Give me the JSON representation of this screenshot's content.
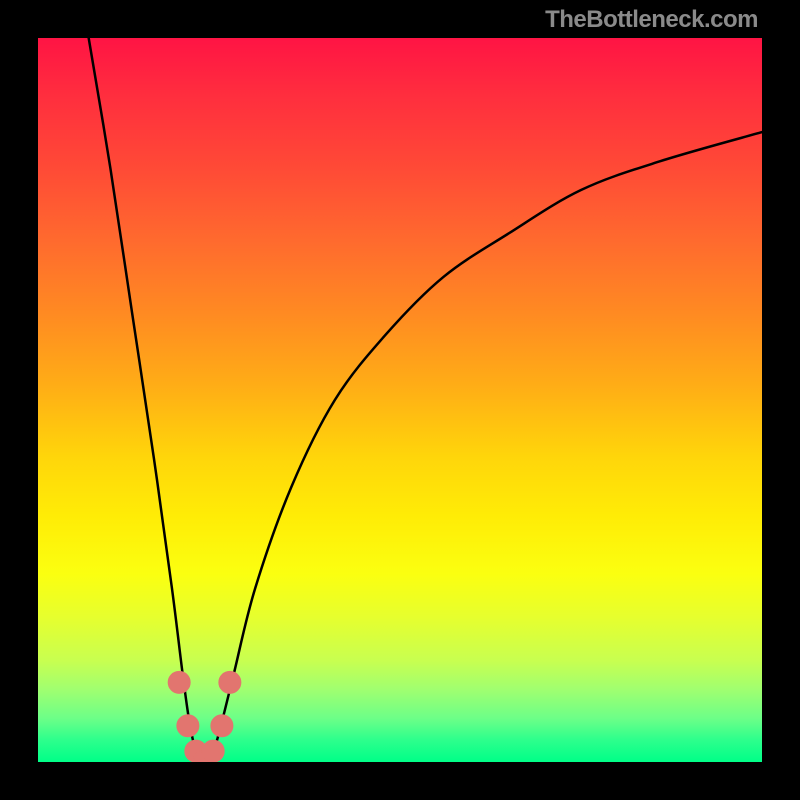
{
  "watermark": "TheBottleneck.com",
  "colors": {
    "page_background": "#000000",
    "curve_stroke": "#000000",
    "marker_fill": "#e2756f",
    "marker_stroke": "#e2756f"
  },
  "chart_data": {
    "type": "line",
    "title": "",
    "xlabel": "",
    "ylabel": "",
    "xlim": [
      0,
      100
    ],
    "ylim": [
      0,
      100
    ],
    "grid": false,
    "legend": false,
    "series": [
      {
        "name": "bottleneck-curve",
        "x": [
          7,
          10,
          13,
          16,
          18.5,
          20,
          21,
          22,
          23,
          24,
          25,
          27,
          30,
          35,
          41,
          48,
          56,
          65,
          75,
          86,
          100
        ],
        "y": [
          100,
          82,
          62,
          42,
          24,
          12,
          5,
          1,
          0.2,
          1,
          4,
          12,
          24,
          38,
          50,
          59,
          67,
          73,
          79,
          83,
          87
        ]
      }
    ],
    "markers": {
      "name": "valley-points",
      "x": [
        19.5,
        20.7,
        21.8,
        23.0,
        24.2,
        25.4,
        26.5
      ],
      "y": [
        11,
        5,
        1.5,
        0.2,
        1.5,
        5,
        11
      ]
    }
  }
}
